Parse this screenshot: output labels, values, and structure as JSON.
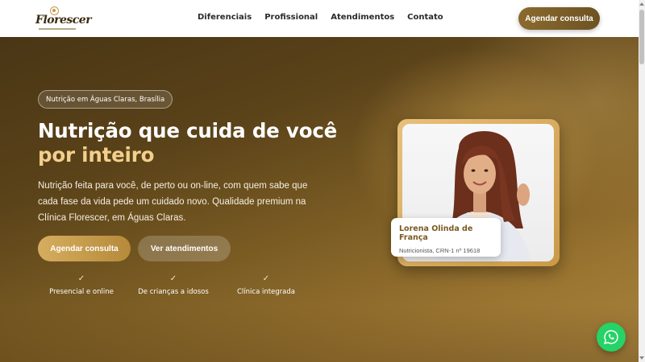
{
  "header": {
    "logo_text": "Florescer",
    "nav": [
      {
        "label": "Diferenciais"
      },
      {
        "label": "Profissional"
      },
      {
        "label": "Atendimentos"
      },
      {
        "label": "Contato"
      }
    ],
    "cta_label": "Agendar consulta"
  },
  "hero": {
    "badge": "Nutrição em Águas Claras, Brasília",
    "title_line1": "Nutrição que cuida de você",
    "title_line2": "por inteiro",
    "description": "Nutrição feita para você, de perto ou on-line, com quem sabe que cada fase da vida pede um cuidado novo. Qualidade premium na Clínica Florescer, em Águas Claras.",
    "primary_button": "Agendar consulta",
    "secondary_button": "Ver atendimentos",
    "features": [
      {
        "label": "Presencial e online"
      },
      {
        "label": "De crianças a idosos"
      },
      {
        "label": "Clínica integrada"
      }
    ]
  },
  "profile": {
    "name": "Lorena Olinda de França",
    "role": "Nutricionista, CRN-1 nº 19618"
  },
  "colors": {
    "gold_accent": "#f2cf8c",
    "button_gold": "#c49a4a",
    "whatsapp_green": "#25d366"
  },
  "icons": {
    "feature_check": "check-icon",
    "floating_button": "whatsapp-icon"
  }
}
